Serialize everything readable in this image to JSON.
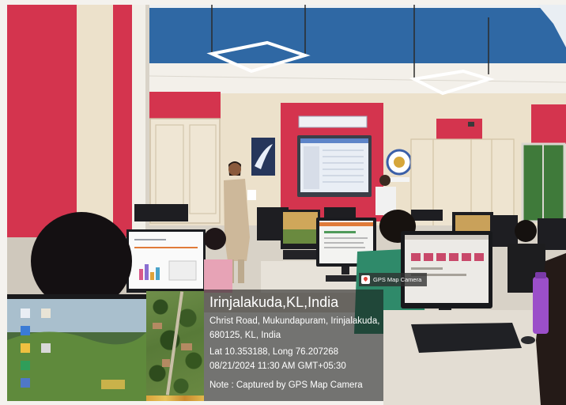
{
  "overlay": {
    "badge_label": "GPS Map Camera",
    "badge_icon": "map-pin-icon",
    "title": "Irinjalakuda,KL,India",
    "address_line1": "Christ Road, Mukundapuram, Irinjalakuda,",
    "address_line2": "680125, KL, India",
    "coordinates": "Lat 10.353188, Long 76.207268",
    "datetime": "08/21/2024 11:30 AM GMT+05:30",
    "note": "Note : Captured by GPS Map Camera"
  },
  "colors": {
    "wall_red": "#d4344e",
    "ceiling_blue": "#2f68a4",
    "cream": "#ece1cb",
    "overlay_text": "#ffffff"
  }
}
